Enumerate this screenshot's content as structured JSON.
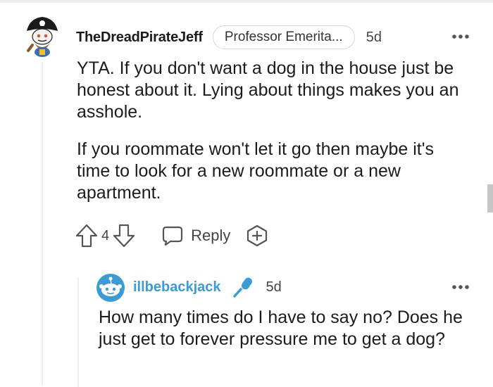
{
  "comment": {
    "username": "TheDreadPirateJeff",
    "flair": "Professor Emerita...",
    "timestamp": "5d",
    "body": [
      "YTA. If you don't want a dog in the house just be honest about it. Lying about things makes you an asshole.",
      "If you roommate won't let it go then maybe it's time to look for a new roommate or a new apartment."
    ],
    "vote_count": "4",
    "reply_label": "Reply",
    "icons": {
      "avatar": "pirate-avatar-icon",
      "more": "more-options-icon",
      "upvote": "upvote-arrow-icon",
      "downvote": "downvote-arrow-icon",
      "reply": "reply-bubble-icon",
      "award": "award-plus-icon"
    }
  },
  "reply": {
    "username": "illbebackjack",
    "timestamp": "5d",
    "body": "How many times do I have to say no? Does he just get to forever pressure me to get a dog?",
    "icons": {
      "avatar": "snoo-avatar-icon",
      "badge": "microphone-icon",
      "more": "more-options-icon"
    }
  },
  "colors": {
    "text": "#1c1c1c",
    "meta": "#444444",
    "reply_username": "#3b9bd5",
    "thread_line": "#edeff1",
    "flair_border": "#d7d7d7"
  }
}
